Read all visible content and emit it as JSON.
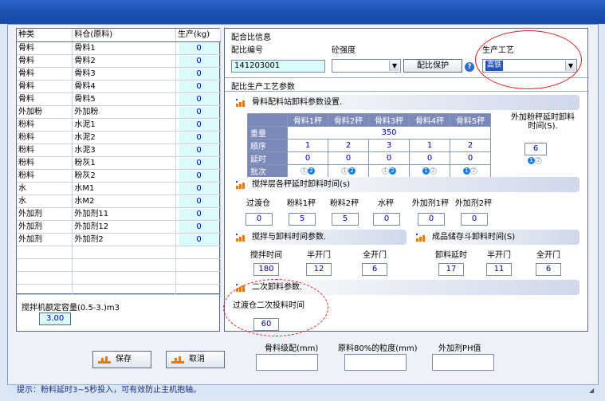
{
  "grid": {
    "headers": [
      "种类",
      "料仓(原料)",
      "生产(kg)"
    ],
    "rows": [
      {
        "type": "骨料",
        "bin": "骨料1",
        "qty": "0"
      },
      {
        "type": "骨料",
        "bin": "骨料2",
        "qty": "0"
      },
      {
        "type": "骨料",
        "bin": "骨料3",
        "qty": "0"
      },
      {
        "type": "骨料",
        "bin": "骨料4",
        "qty": "0"
      },
      {
        "type": "骨料",
        "bin": "骨料5",
        "qty": "0"
      },
      {
        "type": "外加粉",
        "bin": "外加粉",
        "qty": "0"
      },
      {
        "type": "粉料",
        "bin": "水泥1",
        "qty": "0"
      },
      {
        "type": "粉料",
        "bin": "水泥2",
        "qty": "0"
      },
      {
        "type": "粉料",
        "bin": "水泥3",
        "qty": "0"
      },
      {
        "type": "粉料",
        "bin": "粉灰1",
        "qty": "0"
      },
      {
        "type": "粉料",
        "bin": "粉灰2",
        "qty": "0"
      },
      {
        "type": "水",
        "bin": "水M1",
        "qty": "0"
      },
      {
        "type": "水",
        "bin": "水M2",
        "qty": "0"
      },
      {
        "type": "外加剂",
        "bin": "外加剂11",
        "qty": "0"
      },
      {
        "type": "外加剂",
        "bin": "外加剂12",
        "qty": "0"
      },
      {
        "type": "外加剂",
        "bin": "外加剂2",
        "qty": "0"
      }
    ]
  },
  "capacity": {
    "label": "搅拌机额定容量(0.5-3.)m3",
    "value": "3.00"
  },
  "mix_info": {
    "section_title": "配合比信息",
    "mix_no_label": "配比编号",
    "mix_no_value": "141203001",
    "strength_label": "砼强度",
    "protect_button": "配比保护",
    "help_icon": "?",
    "process_label": "生产工艺",
    "process_value": "高铁"
  },
  "process_params": {
    "section_title": "配比生产工艺参数",
    "aggregate_band": "骨料配料站卸料参数设置.",
    "scale_columns": [
      "骨料1秤",
      "骨料2秤",
      "骨料3秤",
      "骨料4秤",
      "骨料5秤"
    ],
    "row_labels": [
      "重量",
      "顺序",
      "延时",
      "批次"
    ],
    "weight": "350",
    "order": [
      "1",
      "2",
      "3",
      "1",
      "2"
    ],
    "delay": [
      "0",
      "0",
      "0",
      "0",
      "0"
    ],
    "batch_active": [
      2,
      2,
      2,
      1,
      1
    ],
    "additive_delay_label": "外加粉秤延时卸料时间(S).",
    "additive_delay_value": "6",
    "additive_batch_active": 1
  },
  "mixer_layer": {
    "band": "搅拌层各秤延时卸料时间(s)",
    "labels": [
      "过渡仓",
      "粉料1秤",
      "粉料2秤",
      "水秤",
      "外加剂1秤",
      "外加剂2秤"
    ],
    "values": [
      "0",
      "5",
      "5",
      "0",
      "0",
      "0"
    ]
  },
  "mix_discharge": {
    "band": "搅拌与卸料时间参数.",
    "labels": [
      "搅拌时间",
      "半开门",
      "全开门"
    ],
    "values": [
      "180",
      "12",
      "6"
    ]
  },
  "storage_discharge": {
    "band": "成品储存斗卸料时间(S)",
    "labels": [
      "卸料延时",
      "半开门",
      "全开门"
    ],
    "values": [
      "17",
      "11",
      "6"
    ]
  },
  "secondary": {
    "band": "二次卸料参数.",
    "label": "过渡仓二次投料时间",
    "value": "60"
  },
  "actions": {
    "save": "保存",
    "cancel": "取消"
  },
  "bottom_fields": {
    "grading_label": "骨料级配(mm)",
    "particle_label": "原料80%的粒度(mm)",
    "ph_label": "外加剂PH值"
  },
  "status": "提示：粉料延时3~5秒投入，可有效防止主机抱轴。",
  "colors": {
    "titlebar": "#1b4fb0",
    "cell_fill": "#d9fbfb",
    "value_text": "#0000c8",
    "annotation": "#e0211f",
    "header_fill": "#7a89b8"
  }
}
